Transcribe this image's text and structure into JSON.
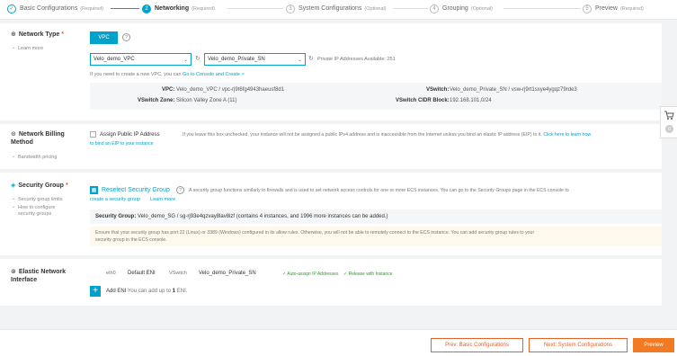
{
  "steps": [
    {
      "num": "✓",
      "title": "Basic Configurations",
      "req": "(Required)"
    },
    {
      "num": "2",
      "title": "Networking",
      "req": "(Required)"
    },
    {
      "num": "3",
      "title": "System Configurations",
      "req": "(Optional)"
    },
    {
      "num": "4",
      "title": "Grouping",
      "req": "(Optional)"
    },
    {
      "num": "5",
      "title": "Preview",
      "req": "(Required)"
    }
  ],
  "network_type": {
    "title": "Network Type",
    "req_mark": "*",
    "learn_more": "Learn more",
    "vpc_button": "VPC",
    "help": "?",
    "vpc_select": "Velo_demo_VPC",
    "vswitch_select": "Velo_demo_Private_SN",
    "refresh_icon": "↻",
    "ip_available": "Private IP Addresses Available: 251",
    "create_hint": "If you need to create a new VPC, you can",
    "create_link": "Go to Console and Create >",
    "vpc_label": "VPC:",
    "vpc_value": "Velo_demo_VPC / vpc-rj9t6fg4943haeusf8d1",
    "vswitch_label": "VSwitch:",
    "vswitch_value": "Velo_demo_Private_SN / vsw-rj9rt1sxye4ygqz79rde3",
    "zone_label": "VSwitch Zone:",
    "zone_value": "Silicon Valley Zone A (11)",
    "cidr_label": "VSwitch CIDR Block:",
    "cidr_value": "192.168.101.0/24"
  },
  "billing": {
    "title_line1": "Network Billing",
    "title_line2": "Method",
    "sub": "Bandwidth pricing",
    "assign_label": "Assign Public IP Address",
    "hint": "If you leave this box unchecked, your instance will not be assigned a public IPv4 address and is inaccessible from the Internet unless you bind an elastic IP address (EIP) to it.",
    "hint_link_a": "Click here to learn how",
    "hint_link_b": "to bind an EIP to your instance"
  },
  "security": {
    "title": "Security Group",
    "req_mark": "*",
    "sub1": "Security group limits",
    "sub2a": "How to configure",
    "sub2b": "security groups",
    "reselect": "Reselect Security Group",
    "help": "?",
    "desc": "A security group functions similarly to firewalls and is used to set network access controls for one or more ECS instances. You can go to the Security Groups page in the ECS console to",
    "desc_link": "create a security group",
    "learn_more": "Learn more",
    "sg_label": "Security Group:",
    "sg_value": "Velo_demo_SG / sg-rj93e4qzvay8lav8izf",
    "sg_detail": "(contains 4 instances, and 1996 more instances can be added.)",
    "warn_a": "Ensure that your security group has port 22 (Linux) or 3389 (Windows) configured in its allow rules. Otherwise, you will not be able to remotely connect to the ECS instance. You can add security group rules to your",
    "warn_b": "security group in the ECS console."
  },
  "eni": {
    "title_line1": "Elastic Network",
    "title_line2": "Interface",
    "eth": "eth0",
    "default_eni": "Default ENI",
    "vswitch_label": "VSwitch",
    "vswitch_value": "Velo_demo_Private_SN",
    "auto_ip": "✓ Auto-assign IP Addresses",
    "release": "✓ Release with Instance",
    "add_label": "Add ENI",
    "add_hint": "You can add up to",
    "add_count": "1",
    "add_unit": "ENI."
  },
  "footer": {
    "prev": "Prev: Basic Configurations",
    "next": "Next: System Configurations",
    "preview": "Preview"
  },
  "side": {
    "cart_icon": "🛒",
    "badge": "0"
  }
}
